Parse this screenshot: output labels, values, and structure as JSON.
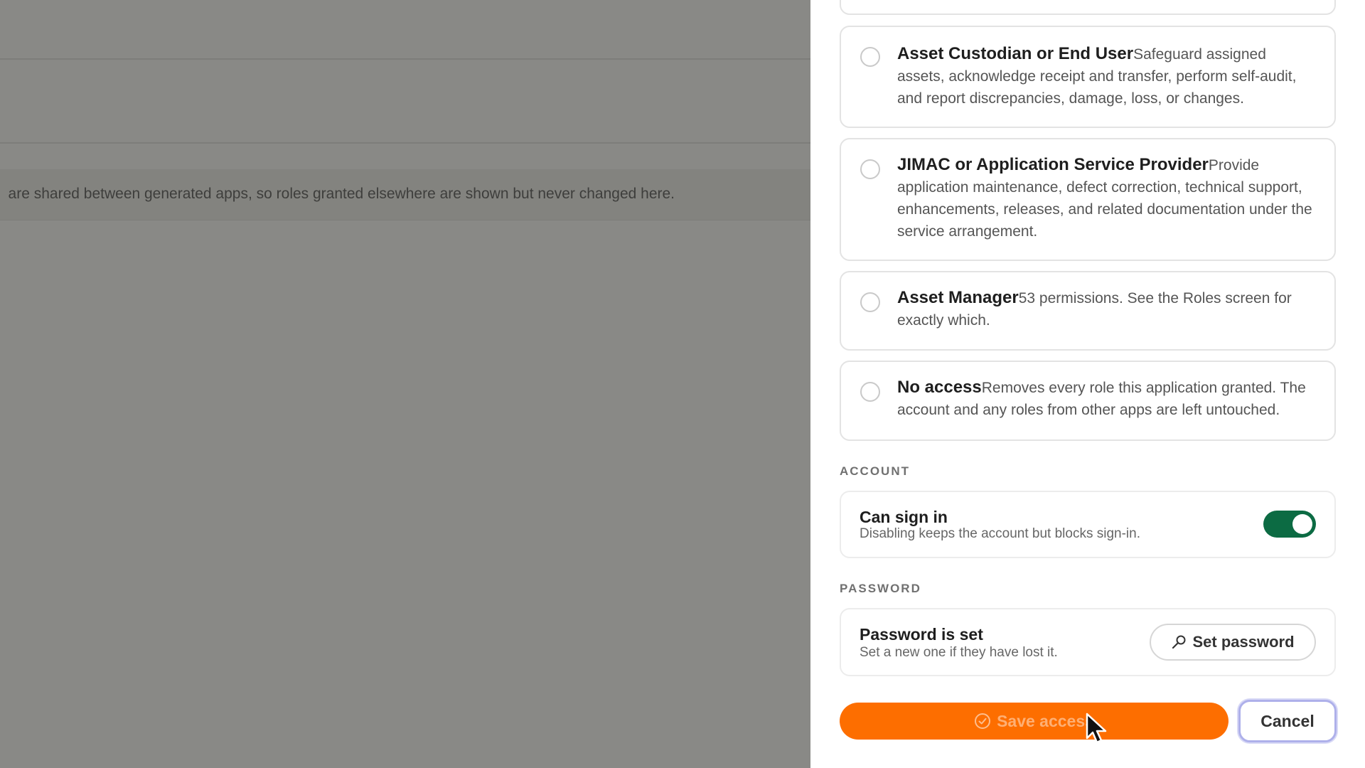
{
  "background": {
    "notice": "are shared between generated apps, so roles granted elsewhere are shown but never changed here."
  },
  "drawer": {
    "roles": [
      {
        "name": "Asset Custodian or End User",
        "description": "Safeguard assigned assets, acknowledge receipt and transfer, perform self-audit, and report discrepancies, damage, loss, or changes.",
        "selected": false
      },
      {
        "name": "JIMAC or Application Service Provider",
        "description": "Provide application maintenance, defect correction, technical support, enhancements, releases, and related documentation under the service arrangement.",
        "selected": false
      },
      {
        "name": "Asset Manager",
        "description": "53 permissions. See the Roles screen for exactly which.",
        "selected": false
      },
      {
        "name": "No access",
        "description": "Removes every role this application granted. The account and any roles from other apps are left untouched.",
        "selected": false
      }
    ],
    "account": {
      "section_label": "ACCOUNT",
      "title": "Can sign in",
      "subtitle": "Disabling keeps the account but blocks sign-in.",
      "enabled": true
    },
    "password": {
      "section_label": "PASSWORD",
      "title": "Password is set",
      "subtitle": "Set a new one if they have lost it.",
      "button_label": "Set password",
      "button_icon": "key-icon"
    },
    "actions": {
      "save_label": "Save access",
      "save_icon": "check-circle-icon",
      "cancel_label": "Cancel"
    },
    "colors": {
      "accent": "#fd6e00",
      "toggle_on": "#0c6b43",
      "focus_ring": "#aeb0ea"
    }
  }
}
